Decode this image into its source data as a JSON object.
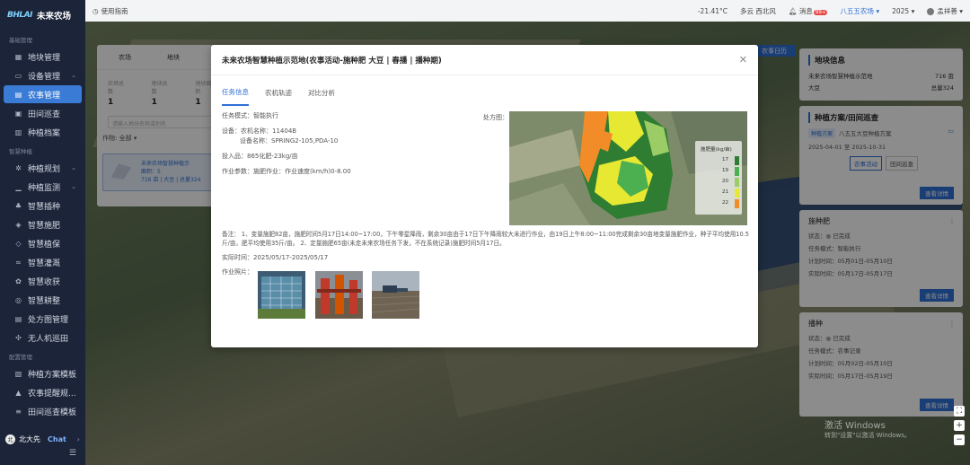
{
  "brand": {
    "logo": "BHLAI",
    "name": "未来农场"
  },
  "sidebar": {
    "groups": [
      {
        "title": "基础管理",
        "items": [
          {
            "label": "地块管理",
            "icon": "map-icon"
          },
          {
            "label": "设备管理",
            "icon": "monitor-icon",
            "caret": true
          },
          {
            "label": "农事管理",
            "icon": "clipboard-icon",
            "active": true
          },
          {
            "label": "田间巡查",
            "icon": "calendar-icon"
          },
          {
            "label": "种植档案",
            "icon": "archive-icon"
          }
        ]
      },
      {
        "title": "智慧种植",
        "items": [
          {
            "label": "种植规划",
            "icon": "gear-icon",
            "caret": true
          },
          {
            "label": "种植监测",
            "icon": "chart-icon",
            "caret": true
          },
          {
            "label": "智慧插种",
            "icon": "sprout-icon"
          },
          {
            "label": "智慧施肥",
            "icon": "fertilizer-icon"
          },
          {
            "label": "智慧植保",
            "icon": "shield-icon"
          },
          {
            "label": "智慧灌溉",
            "icon": "water-icon"
          },
          {
            "label": "智慧收获",
            "icon": "harvest-icon"
          },
          {
            "label": "智慧耕整",
            "icon": "tractor-icon"
          },
          {
            "label": "处方图管理",
            "icon": "doc-icon"
          },
          {
            "label": "无人机巡田",
            "icon": "drone-icon"
          }
        ]
      },
      {
        "title": "配置管理",
        "items": [
          {
            "label": "种植方案模板",
            "icon": "template-icon"
          },
          {
            "label": "农事提醒规...",
            "icon": "bell-icon"
          },
          {
            "label": "田间巡查模板",
            "icon": "list-icon"
          }
        ]
      }
    ],
    "footer": {
      "avatar": "北",
      "name": "北大先",
      "chat": "Chat"
    }
  },
  "topbar": {
    "guide": "使用指南",
    "weather": "-21.41°C",
    "weather_desc": "多云 西北风",
    "message_label": "消息",
    "message_badge": "99+",
    "farm": "八五五农场",
    "year": "2025",
    "user": "孟祥善"
  },
  "bg_left": {
    "tabs": [
      "农场",
      "地块"
    ],
    "stats": [
      {
        "label": "农场总数",
        "value": "1"
      },
      {
        "label": "地块总数",
        "value": "1"
      },
      {
        "label": "地块面积",
        "value": "1"
      }
    ],
    "search_placeholder": "请输入地块名称或别名",
    "filter_label": "作物:",
    "filter_value": "全部",
    "card_title": "未来农场智慧种植示",
    "card_line1": "面积：5",
    "card_line2": "716 亩 | 大豆 | 总量324"
  },
  "bg_history_btn": "农事日历",
  "right_panel": {
    "plot_title": "地块信息",
    "plot_rows": [
      {
        "k": "未来农场智慧种植示范地",
        "v": "716 亩"
      },
      {
        "k": "大豆",
        "v": "总量324"
      }
    ],
    "plan_title": "种植方案/田间巡查",
    "plan_tag": "种植方案",
    "plan_name": "八五五大豆种植方案",
    "plan_date": "2025-04-01 至 2025-10-31",
    "seg": [
      "农事活动",
      "田间巡查"
    ],
    "more_btn": "查看详情",
    "cards": [
      {
        "title": "施种肥",
        "kv": [
          {
            "k": "状态：",
            "v": "已完成"
          },
          {
            "k": "任务模式：",
            "v": "智能执行"
          },
          {
            "k": "计划时间：",
            "v": "05月01日-05月10日"
          },
          {
            "k": "实际时间：",
            "v": "05月17日-05月17日"
          }
        ],
        "btn": "查看详情"
      },
      {
        "title": "播种",
        "kv": [
          {
            "k": "状态：",
            "v": "已完成"
          },
          {
            "k": "任务模式：",
            "v": "农事记录"
          },
          {
            "k": "计划时间：",
            "v": "05月02日-05月10日"
          },
          {
            "k": "实际时间：",
            "v": "05月17日-05月19日"
          }
        ],
        "btn": "查看详情"
      }
    ]
  },
  "watermark": {
    "line1": "激活 Windows",
    "line2": "转到\"设置\"以激活 Windows。"
  },
  "modal": {
    "title": "未来农场智慧种植示范地(农事活动-施种肥 大豆 | 春播 | 播种期)",
    "tabs": [
      "任务信息",
      "农机轨迹",
      "对比分析"
    ],
    "task_mode": "任务模式：智能执行",
    "device": "设备：农机名称：11404B",
    "device_name": "设备名称：SPRING2-105,PDA-10",
    "inputs": "投入品：865化肥-23kg/亩",
    "params": "作业参数：施肥作业：作业速度(km/h)0-8.00",
    "rx_label": "处方图：",
    "legend": {
      "title": "施肥量(kg/亩)",
      "items": [
        {
          "value": "17",
          "color": "#2e7d32"
        },
        {
          "value": "19",
          "color": "#4caf50"
        },
        {
          "value": "20",
          "color": "#9ccc65"
        },
        {
          "value": "21",
          "color": "#e6e832"
        },
        {
          "value": "22",
          "color": "#f28c28"
        }
      ]
    },
    "remark": "备注：   1、变量施肥82亩，施肥时间5月17日14:00~17:00，下午零星降雨，剩余30亩由于17日下午降雨较大未进行作业，由19日上午8:00~11:00完成剩余30亩地变量施肥作业，种子平均使用10.5斤/亩，肥平均使用35斤/亩。 2、定量施肥65亩(未走未来农场任务下发，不在系统记录)施肥时间5月17日。",
    "actual_time": "实际时间：2025/05/17-2025/05/17",
    "photos_label": "作业照片："
  }
}
